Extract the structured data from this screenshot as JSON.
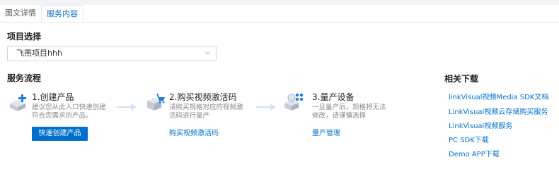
{
  "tabs": [
    "图文详情",
    "服务内容"
  ],
  "project": {
    "heading": "项目选择",
    "selected": "飞燕项目hhh"
  },
  "flow": {
    "heading": "服务流程",
    "steps": [
      {
        "title": "1.创建产品",
        "desc": "建议您从此入口快速创建符合您需求的产品。",
        "action": "快速创建产品"
      },
      {
        "title": "2.购买视频激活码",
        "desc": "请购买规格对应的视频激活码进行量产",
        "action": "购买视频激活码"
      },
      {
        "title": "3.量产设备",
        "desc": "一旦量产后，规格将无法修改，请谨慎选择",
        "action": "量产管理"
      }
    ]
  },
  "downloads": {
    "heading": "相关下载",
    "links": [
      "linkVisual视频Media SDK文档",
      "LinkVisual视频云存储购买服务",
      "LinkVisual视频服务",
      "PC SDK下载",
      "Demo APP下载"
    ]
  },
  "colors": {
    "accent": "#0070cc"
  }
}
